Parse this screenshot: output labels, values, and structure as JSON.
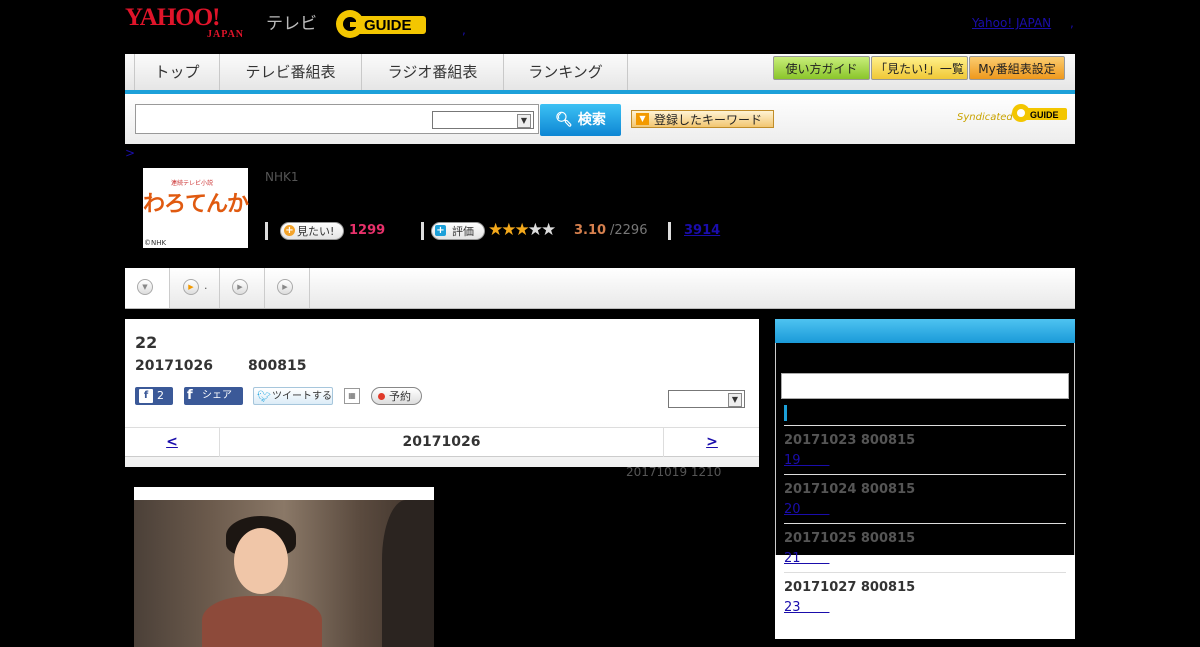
{
  "header": {
    "yahoo_logo": "YAHOO!",
    "yahoo_logo_sub": "JAPAN",
    "tv_label": "テレビ",
    "gguide_logo": "GUIDE",
    "dot": ",",
    "yahoo_japan_link": "Yahoo! JAPAN",
    "yahoo_japan_dot": ","
  },
  "nav": {
    "tabs": [
      {
        "label": "トップ"
      },
      {
        "label": "テレビ番組表"
      },
      {
        "label": "ラジオ番組表"
      },
      {
        "label": "ランキング"
      }
    ],
    "right_buttons": [
      {
        "label": "使い方ガイド",
        "color": "#9bd33a"
      },
      {
        "label": "「見たい!」一覧",
        "color": "#f7d64a"
      },
      {
        "label": "My番組表設定",
        "color": "#f3a32a"
      }
    ]
  },
  "search": {
    "button_label": "検索",
    "keyword_button": "登録したキーワード",
    "syndicated": "Syndicated",
    "syn_logo": "GUIDE"
  },
  "breadcrumb": ">",
  "program": {
    "thumb_title": "わろてんか",
    "thumb_small": "連続テレビ小説",
    "thumb_copyright": "©NHK",
    "channel": "NHK1",
    "want_label": "見たい!",
    "want_count": "1299",
    "rate_label": "評価",
    "rating": "3.10",
    "rating_total": "/2296",
    "extra_count": "3914",
    "stars_on": 3,
    "stars_total": 5
  },
  "subtabs": {
    "tab2_label": "."
  },
  "episode": {
    "title": "22",
    "date": "20171026",
    "time": "800815",
    "fb_count": "2",
    "fb_share": "シェア",
    "tweet": "ツイートする",
    "reserve": "予約",
    "prev": "<",
    "nav_date": "20171026",
    "next": ">",
    "updated": "20171019  1210"
  },
  "sidebar": {
    "items": [
      {
        "date": "20171023  800815",
        "episode": "19       "
      },
      {
        "date": "20171024  800815",
        "episode": "20       "
      },
      {
        "date": "20171025  800815",
        "episode": "21       "
      },
      {
        "date": "20171027  800815",
        "episode": "23       "
      }
    ]
  },
  "colors": {
    "accent": "#1ca0d9",
    "want_count": "#e8316b",
    "rating": "#d6804e",
    "brand_red": "#e0142a"
  }
}
